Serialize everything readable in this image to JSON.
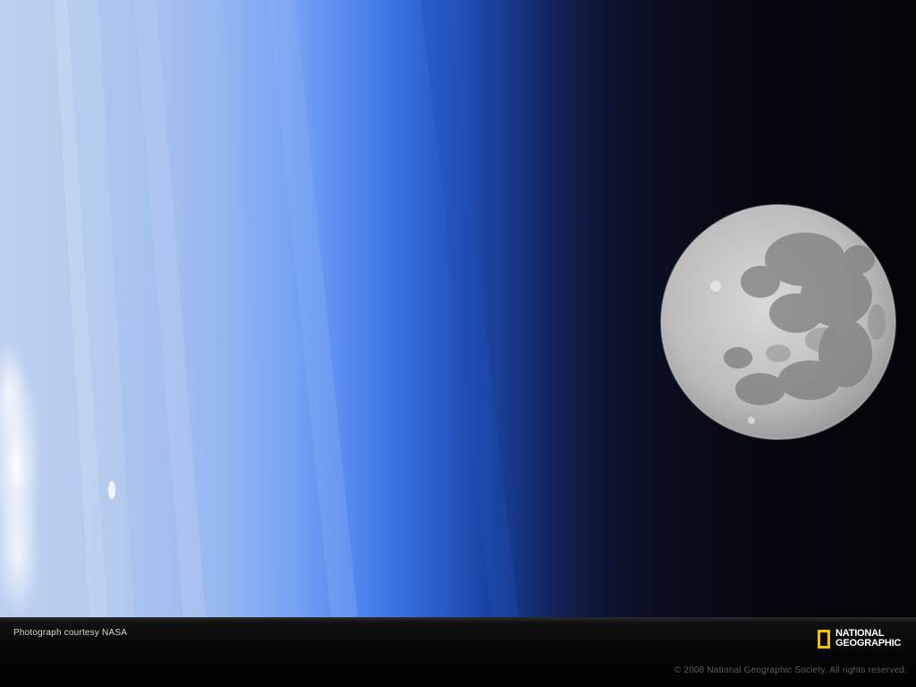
{
  "scene": {
    "description_colors": {
      "atmosphere_light": "#a9c3ee",
      "atmosphere_blue": "#3a74e2",
      "space": "#030308",
      "moon": "#bdbdbd"
    }
  },
  "footer": {
    "credit": "Photograph courtesy NASA",
    "copyright": "© 2008 National Geographic Society. All rights reserved.",
    "logo": {
      "line1": "NATIONAL",
      "line2": "GEOGRAPHIC",
      "frame_color": "#f3c300",
      "icon": "yellow-rectangle-frame-icon"
    }
  }
}
